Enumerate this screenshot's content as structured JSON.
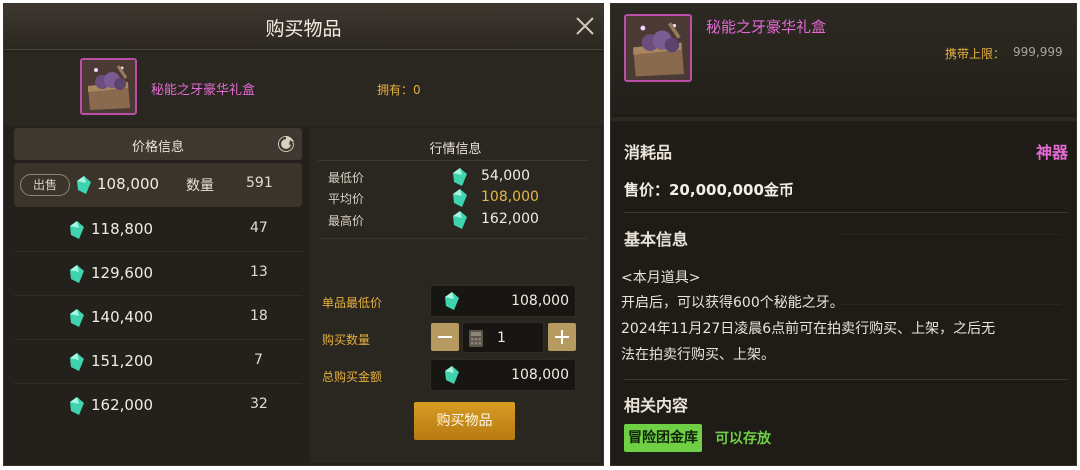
{
  "dialog": {
    "title": "购买物品",
    "item_name": "秘能之牙豪华礼盒",
    "owned_label": "拥有：0",
    "price_info_title": "价格信息",
    "sell_tag": "出售",
    "quantity_label": "数量",
    "listings": [
      {
        "price": "108,000",
        "qty": "591"
      },
      {
        "price": "118,800",
        "qty": "47"
      },
      {
        "price": "129,600",
        "qty": "13"
      },
      {
        "price": "140,400",
        "qty": "18"
      },
      {
        "price": "151,200",
        "qty": "7"
      },
      {
        "price": "162,000",
        "qty": "32"
      }
    ],
    "market_title": "行情信息",
    "market": {
      "min_label": "最低价",
      "min_val": "54,000",
      "avg_label": "平均价",
      "avg_val": "108,000",
      "max_label": "最高价",
      "max_val": "162,000"
    },
    "form": {
      "unit_price_label": "单品最低价",
      "unit_price_val": "108,000",
      "buy_qty_label": "购买数量",
      "buy_qty_val": "1",
      "total_label": "总购买金额",
      "total_val": "108,000"
    },
    "buy_button": "购买物品"
  },
  "tooltip": {
    "item_name": "秘能之牙豪华礼盒",
    "carry_label": "携带上限：",
    "carry_val": "999,999",
    "category": "消耗品",
    "grade": "神器",
    "sale_price": "售价：20,000,000金币",
    "basic_info_title": "基本信息",
    "desc_lines": [
      "<本月道具>",
      "开启后，可以获得600个秘能之牙。",
      "2024年11月27日凌晨6点前可在拍卖行购买、上架，之后无",
      "法在拍卖行购买、上架。"
    ],
    "related_title": "相关内容",
    "storage_badge": "冒险团金库",
    "storage_text": "可以存放"
  },
  "colors": {
    "epic_purple": "#e36ad2",
    "gold_text": "#e5b03e",
    "buy_button": "#c98b1a",
    "storage_green": "#6fd046",
    "gem_teal": "#3fd3b0"
  },
  "icons": [
    "close-icon",
    "refresh-icon",
    "gem-icon",
    "calculator-icon",
    "minus-icon",
    "plus-icon",
    "gift-box-icon"
  ]
}
